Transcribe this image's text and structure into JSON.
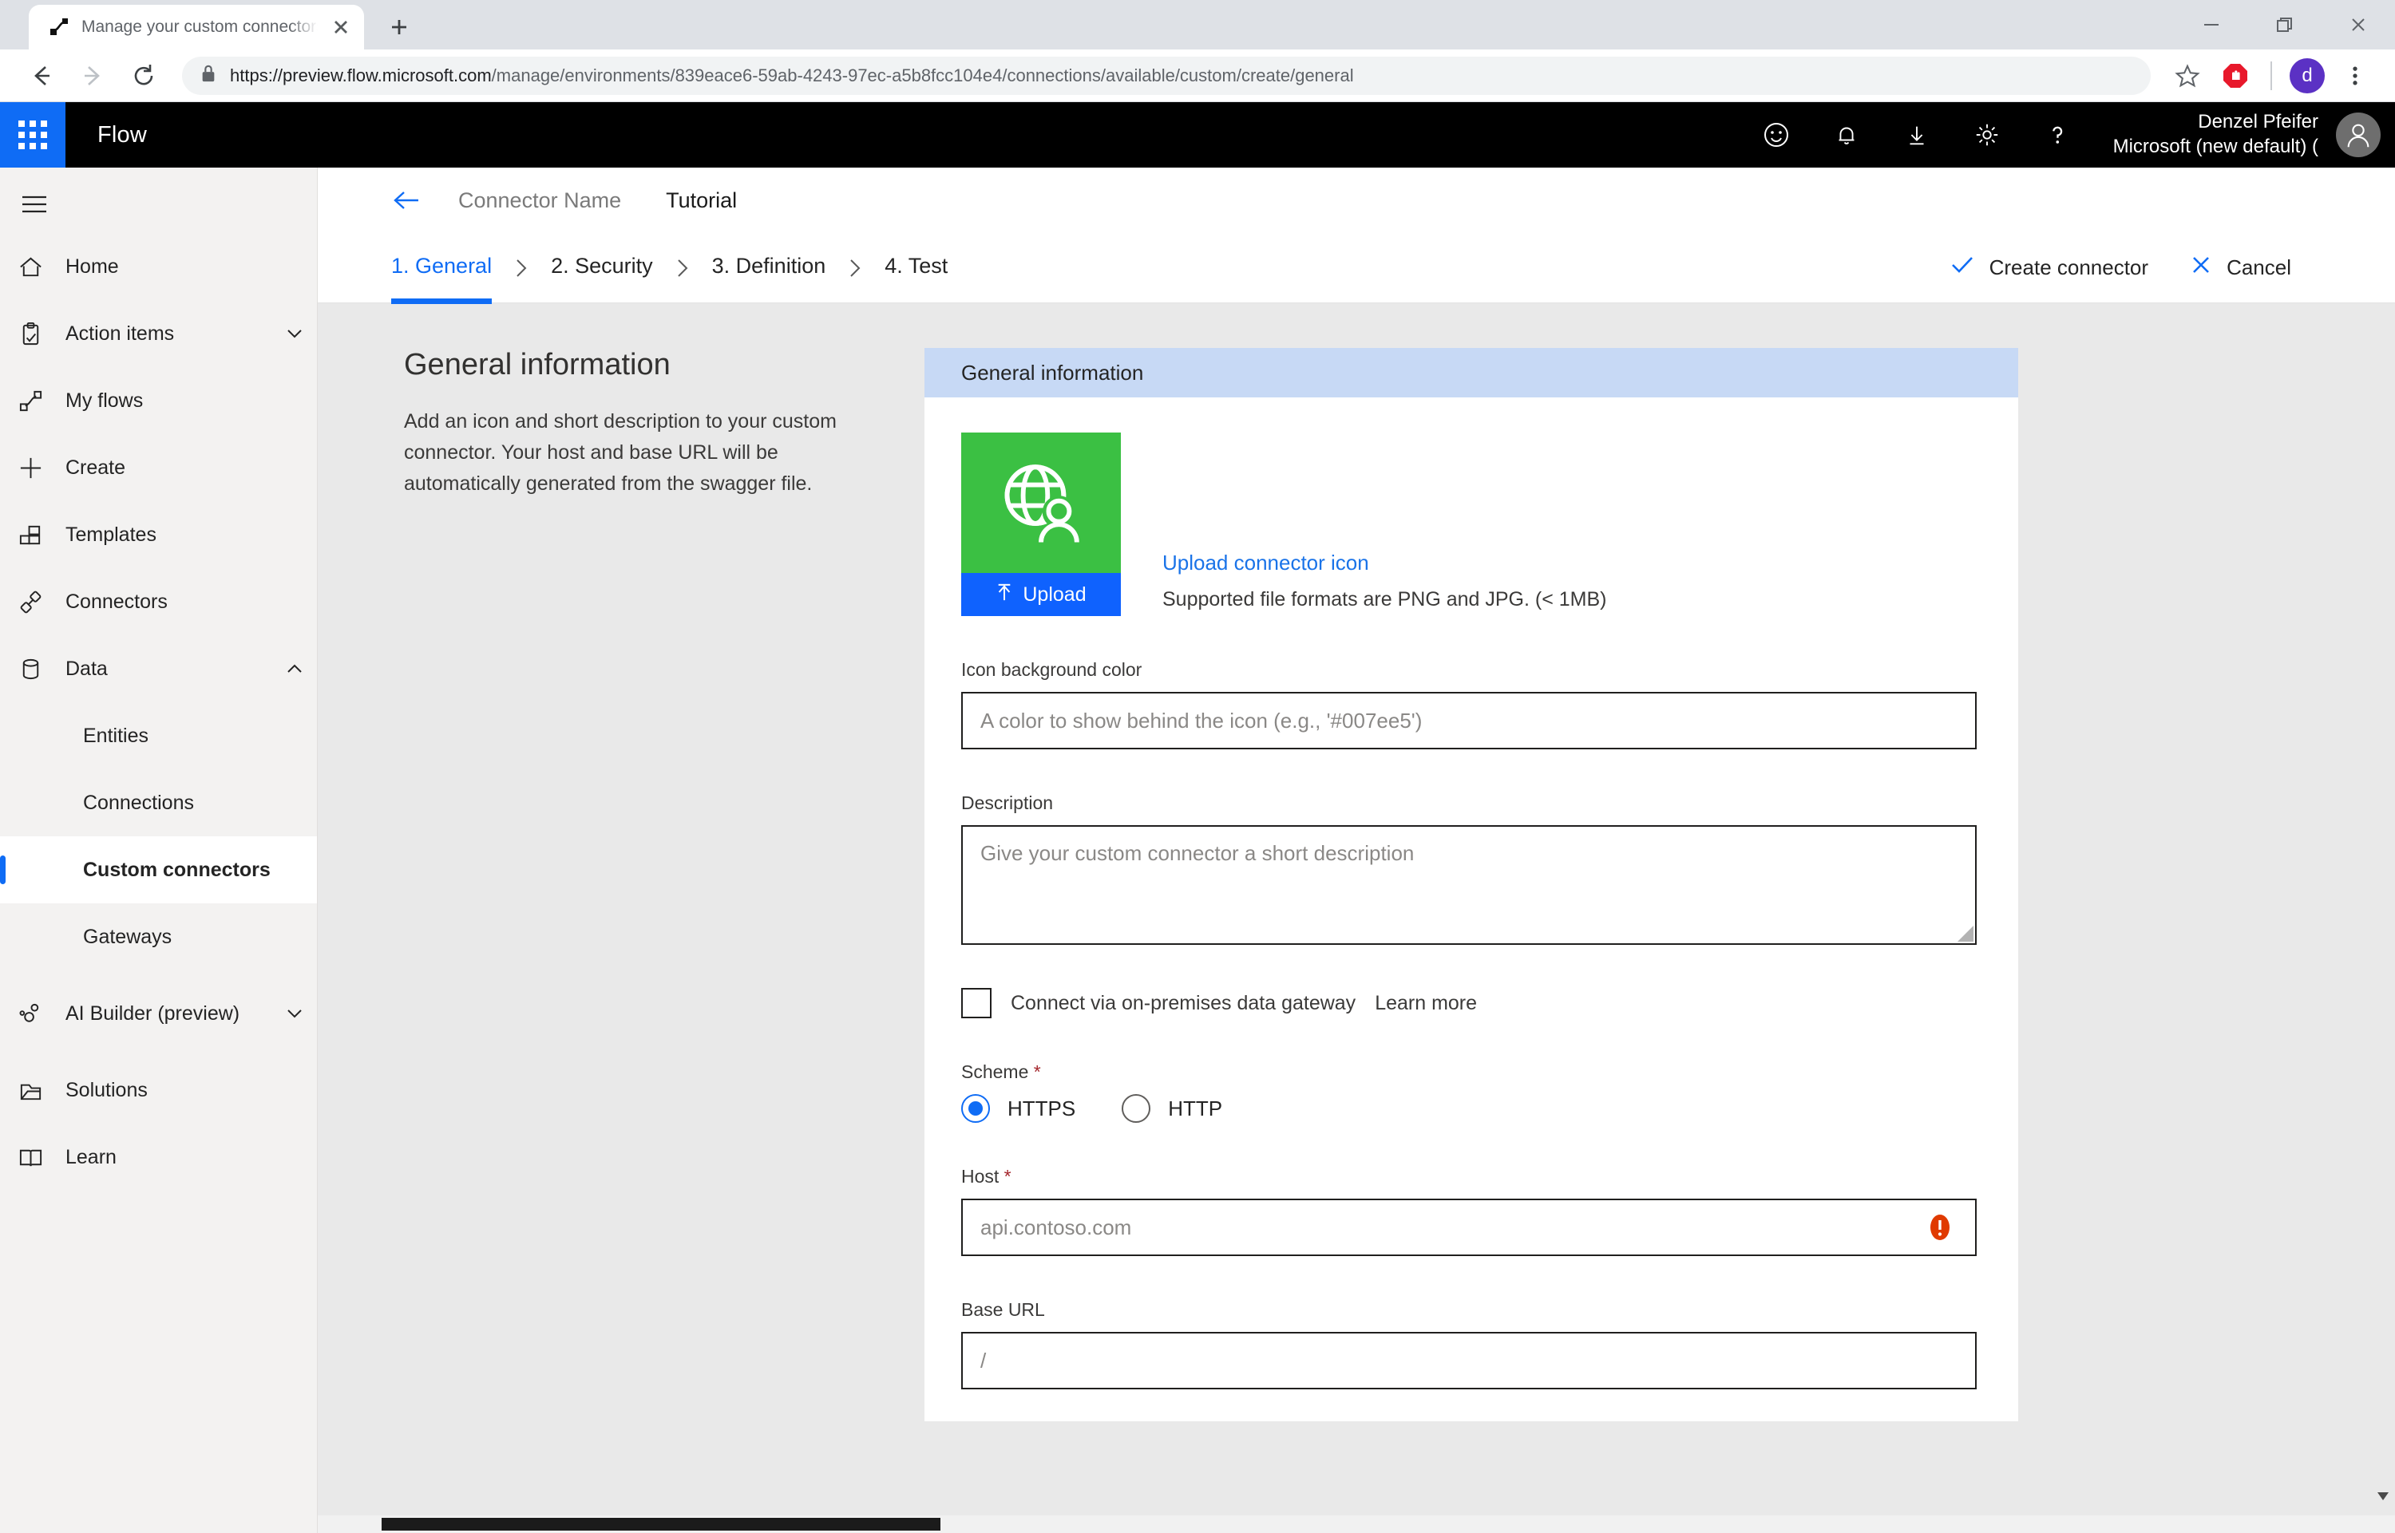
{
  "browser": {
    "tab": {
      "title": "Manage your custom connectors",
      "favicon": "flow-favicon"
    },
    "new_tab_label": "+",
    "window_controls": {
      "minimize": "minimize-icon",
      "restore": "restore-icon",
      "close": "close-icon"
    },
    "url_scheme_host": "https://preview.flow.microsoft.com",
    "url_path": "/manage/environments/839eace6-59ab-4243-97ec-a5b8fcc104e4/connections/available/custom/create/general",
    "toolbar_icons": [
      "back-icon",
      "forward-icon",
      "reload-icon",
      "lock-icon",
      "bookmark-star-icon",
      "adblock-icon",
      "browser-profile-avatar",
      "browser-menu-icon"
    ],
    "profile_initial": "d"
  },
  "app_header": {
    "brand": "Flow",
    "icons": [
      "waffle-icon",
      "feedback-smiley-icon",
      "notification-bell-icon",
      "download-icon",
      "settings-gear-icon",
      "help-question-icon"
    ],
    "user_name": "Denzel Pfeifer",
    "environment": "Microsoft (new default) (",
    "accent": "#0f6cf5"
  },
  "sidebar": {
    "items": [
      {
        "label": "Home",
        "icon": "home-icon",
        "expandable": false,
        "selected": false,
        "sub": false
      },
      {
        "label": "Action items",
        "icon": "clipboard-check-icon",
        "expandable": true,
        "chevron": "down",
        "selected": false,
        "sub": false
      },
      {
        "label": "My flows",
        "icon": "flow-icon",
        "expandable": false,
        "selected": false,
        "sub": false
      },
      {
        "label": "Create",
        "icon": "plus-icon",
        "expandable": false,
        "selected": false,
        "sub": false
      },
      {
        "label": "Templates",
        "icon": "templates-icon",
        "expandable": false,
        "selected": false,
        "sub": false
      },
      {
        "label": "Connectors",
        "icon": "connector-plug-icon",
        "expandable": false,
        "selected": false,
        "sub": false
      },
      {
        "label": "Data",
        "icon": "database-icon",
        "expandable": true,
        "chevron": "up",
        "selected": false,
        "sub": false
      },
      {
        "label": "Entities",
        "icon": "",
        "expandable": false,
        "selected": false,
        "sub": true
      },
      {
        "label": "Connections",
        "icon": "",
        "expandable": false,
        "selected": false,
        "sub": true
      },
      {
        "label": "Custom connectors",
        "icon": "",
        "expandable": false,
        "selected": true,
        "sub": true
      },
      {
        "label": "Gateways",
        "icon": "",
        "expandable": false,
        "selected": false,
        "sub": true
      },
      {
        "label": "AI Builder (preview)",
        "icon": "ai-builder-icon",
        "expandable": true,
        "chevron": "down",
        "selected": false,
        "sub": false
      },
      {
        "label": "Solutions",
        "icon": "solutions-icon",
        "expandable": false,
        "selected": false,
        "sub": false
      },
      {
        "label": "Learn",
        "icon": "book-icon",
        "expandable": false,
        "selected": false,
        "sub": false
      }
    ]
  },
  "breadcrumb": {
    "back_icon": "back-arrow-icon",
    "connector_name": "Connector Name",
    "page_label": "Tutorial"
  },
  "wizard": {
    "steps": [
      {
        "label": "1. General",
        "active": true
      },
      {
        "label": "2. Security",
        "active": false
      },
      {
        "label": "3. Definition",
        "active": false
      },
      {
        "label": "4. Test",
        "active": false
      }
    ],
    "separator": "chevron-right-icon",
    "create_label": "Create connector",
    "cancel_label": "Cancel"
  },
  "description_panel": {
    "title": "General information",
    "text": "Add an icon and short description to your custom connector. Your host and base URL will be automatically generated from the swagger file."
  },
  "form": {
    "panel_title": "General information",
    "icon_tile": {
      "background_color": "#3bc043",
      "glyph": "globe-person-icon",
      "upload_button_label": "Upload",
      "upload_button_icon": "upload-arrow-icon",
      "upload_button_color": "#0f62fe"
    },
    "upload_link": "Upload connector icon",
    "upload_hint": "Supported file formats are PNG and JPG. (< 1MB)",
    "icon_bg_color": {
      "label": "Icon background color",
      "placeholder": "A color to show behind the icon (e.g., '#007ee5')",
      "value": ""
    },
    "description": {
      "label": "Description",
      "placeholder": "Give your custom connector a short description",
      "value": ""
    },
    "gateway": {
      "checked": false,
      "label": "Connect via on-premises data gateway",
      "learn_more": "Learn more"
    },
    "scheme": {
      "label": "Scheme",
      "required": true,
      "options": [
        {
          "label": "HTTPS",
          "selected": true
        },
        {
          "label": "HTTP",
          "selected": false
        }
      ]
    },
    "host": {
      "label": "Host",
      "required": true,
      "placeholder": "api.contoso.com",
      "value": "",
      "error_icon": "error-exclamation-icon",
      "error_color": "#e03a00"
    },
    "base_url": {
      "label": "Base URL",
      "required": false,
      "placeholder": "/",
      "value": ""
    }
  }
}
